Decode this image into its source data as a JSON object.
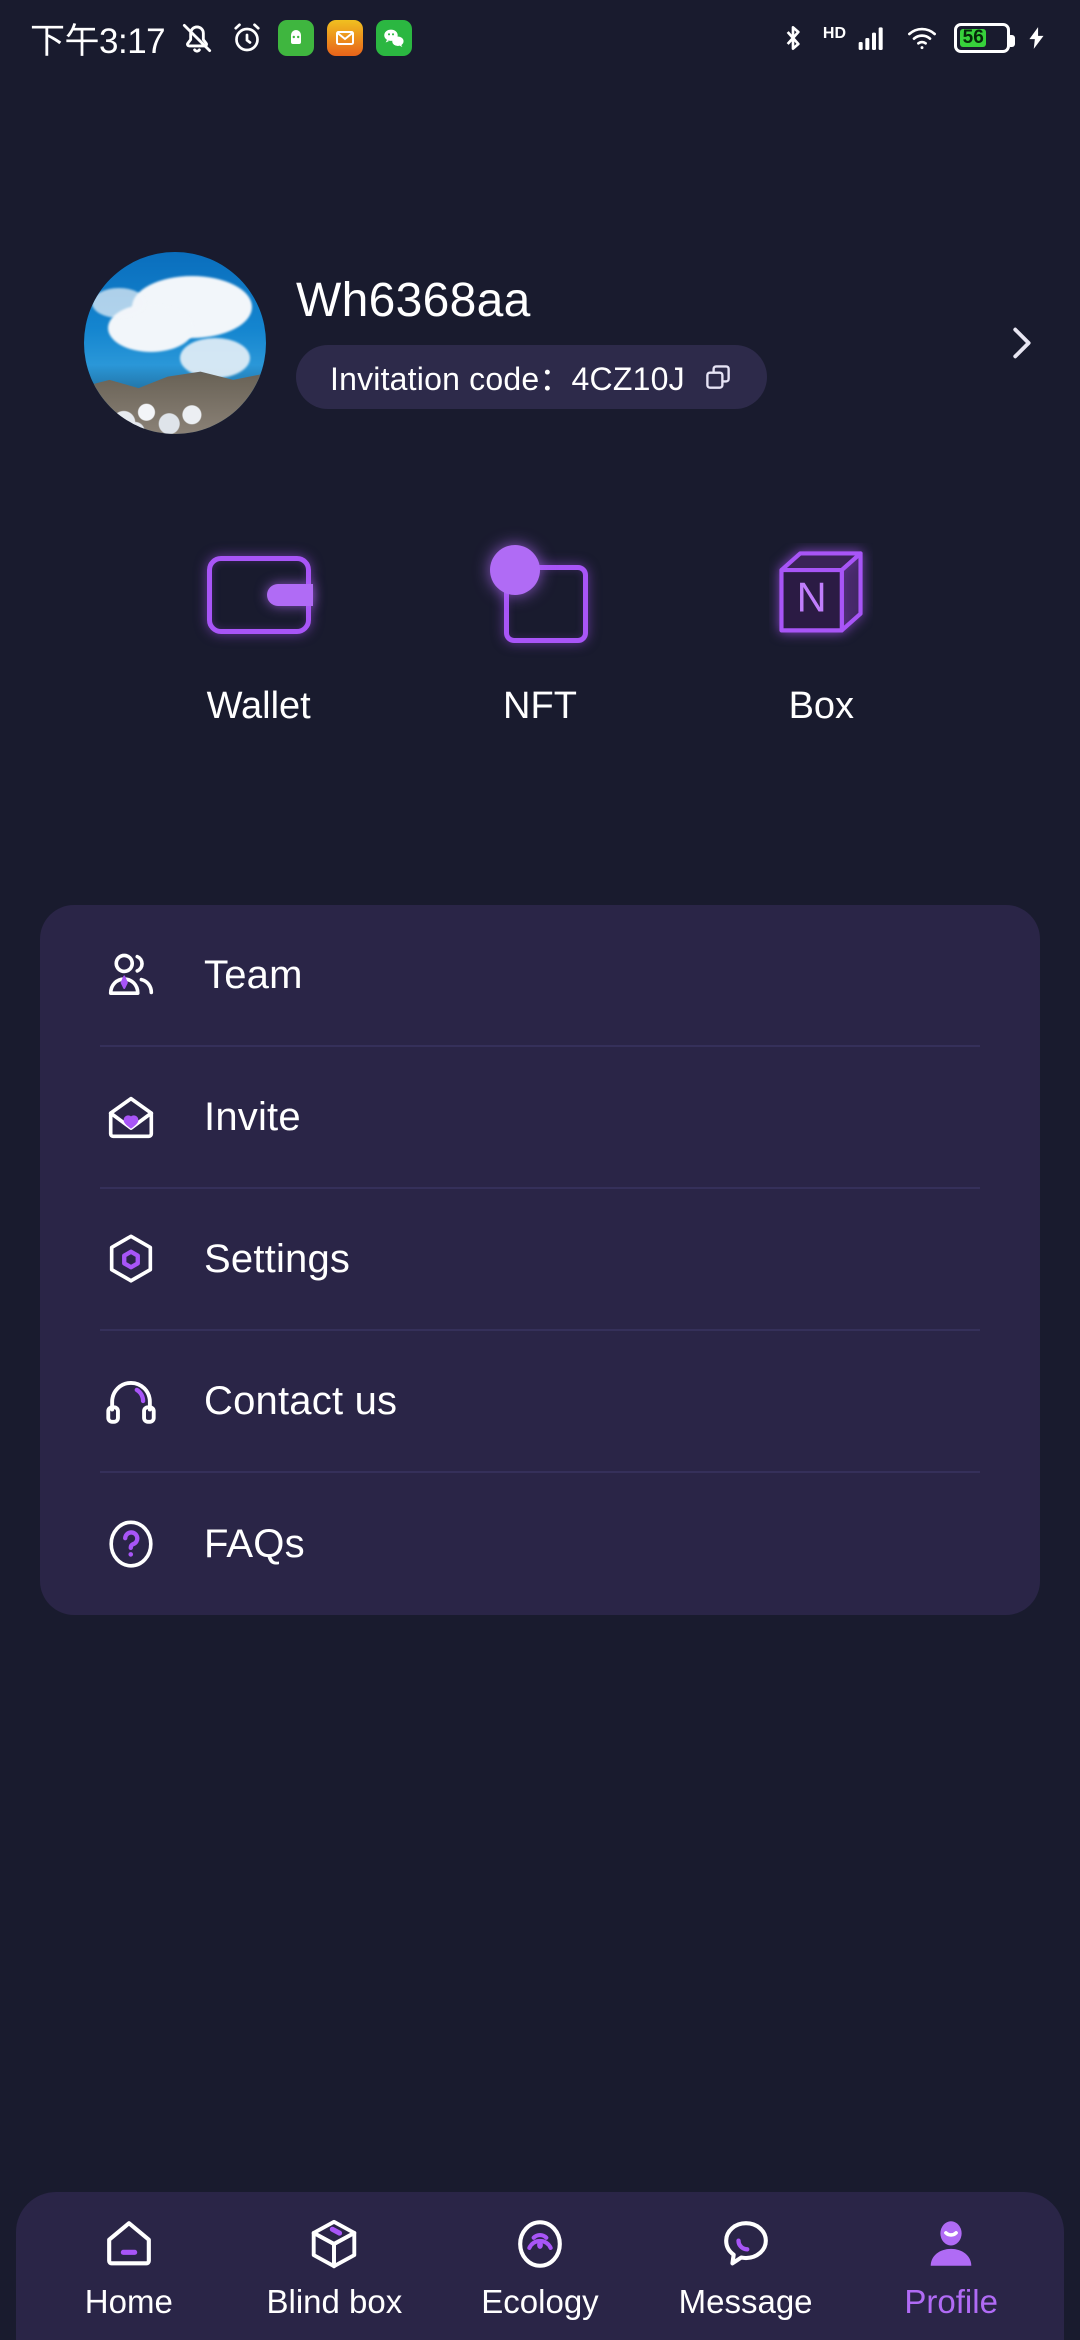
{
  "theme": {
    "background": "#191b2e",
    "card": "#2a2547",
    "accent": "#b06bf5",
    "accent_outline": "#a855f7",
    "text": "#ffffff",
    "divider": "#35305a",
    "pill": "#2d2a4a",
    "battery_fill": "#37d13b"
  },
  "status_bar": {
    "time": "下午3:17",
    "left_icons": [
      {
        "name": "mute-bell-icon",
        "glyph": "silent"
      },
      {
        "name": "alarm-clock-icon",
        "glyph": "alarm"
      },
      {
        "name": "app-green-icon",
        "glyph": "app"
      },
      {
        "name": "mail-app-icon",
        "glyph": "mail"
      },
      {
        "name": "wechat-app-icon",
        "glyph": "wechat"
      }
    ],
    "right_icons": [
      {
        "name": "bluetooth-icon"
      },
      {
        "name": "hd-icon",
        "label": "HD"
      },
      {
        "name": "cellular-signal-icon"
      },
      {
        "name": "wifi-icon"
      },
      {
        "name": "battery-icon",
        "level": "56"
      },
      {
        "name": "charging-bolt-icon"
      }
    ]
  },
  "profile": {
    "avatar_alt": "landscape-photo-avatar",
    "username": "Wh6368aa",
    "invitation_label": "Invitation code：4CZ10J",
    "invitation_code": "4CZ10J",
    "copy_icon": "copy-icon",
    "chevron": "chevron-right-icon"
  },
  "quick_actions": [
    {
      "label": "Wallet",
      "icon": "wallet-icon"
    },
    {
      "label": "NFT",
      "icon": "nft-icon"
    },
    {
      "label": "Box",
      "icon": "box-cube-icon",
      "cube_letter": "N"
    }
  ],
  "menu": {
    "items": [
      {
        "label": "Team",
        "icon": "people-group-icon"
      },
      {
        "label": "Invite",
        "icon": "envelope-heart-icon"
      },
      {
        "label": "Settings",
        "icon": "hexagon-gear-icon"
      },
      {
        "label": "Contact us",
        "icon": "headset-icon"
      },
      {
        "label": "FAQs",
        "icon": "question-circle-icon"
      }
    ]
  },
  "bottom_nav": {
    "items": [
      {
        "label": "Home",
        "icon": "home-icon",
        "active": false
      },
      {
        "label": "Blind box",
        "icon": "cube-icon",
        "active": false
      },
      {
        "label": "Ecology",
        "icon": "ecology-circle-icon",
        "active": false
      },
      {
        "label": "Message",
        "icon": "chat-bubble-icon",
        "active": false
      },
      {
        "label": "Profile",
        "icon": "person-icon",
        "active": true
      }
    ]
  }
}
